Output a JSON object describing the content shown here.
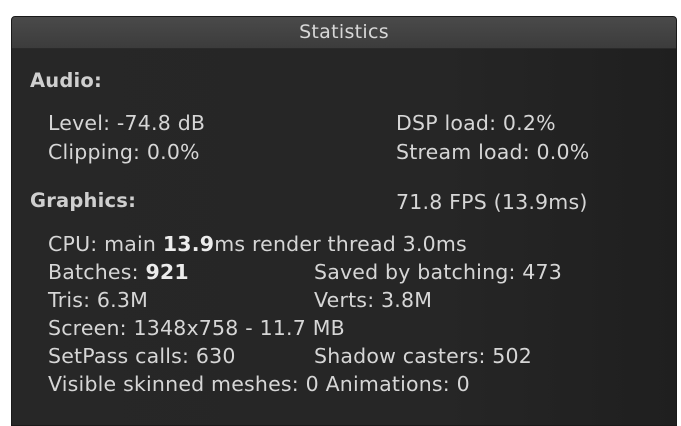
{
  "window": {
    "title": "Statistics"
  },
  "audio": {
    "heading": "Audio:",
    "level": "Level: -74.8 dB",
    "dsp_load": "DSP load: 0.2%",
    "clipping": "Clipping: 0.0%",
    "stream_load": "Stream load: 0.0%"
  },
  "graphics": {
    "heading": "Graphics:",
    "fps": "71.8 FPS (13.9ms)",
    "cpu_prefix": "CPU: main ",
    "cpu_main_value": "13.9",
    "cpu_suffix": "ms  render thread 3.0ms",
    "batches_prefix": "Batches: ",
    "batches_value": "921",
    "saved_by_batching": "Saved by batching: 473",
    "tris": "Tris: 6.3M",
    "verts": "Verts: 3.8M",
    "screen": "Screen: 1348x758 - 11.7 MB",
    "setpass_calls": "SetPass calls: 630",
    "shadow_casters": "Shadow casters: 502",
    "visible_skinned": "Visible skinned meshes: 0  Animations: 0"
  }
}
